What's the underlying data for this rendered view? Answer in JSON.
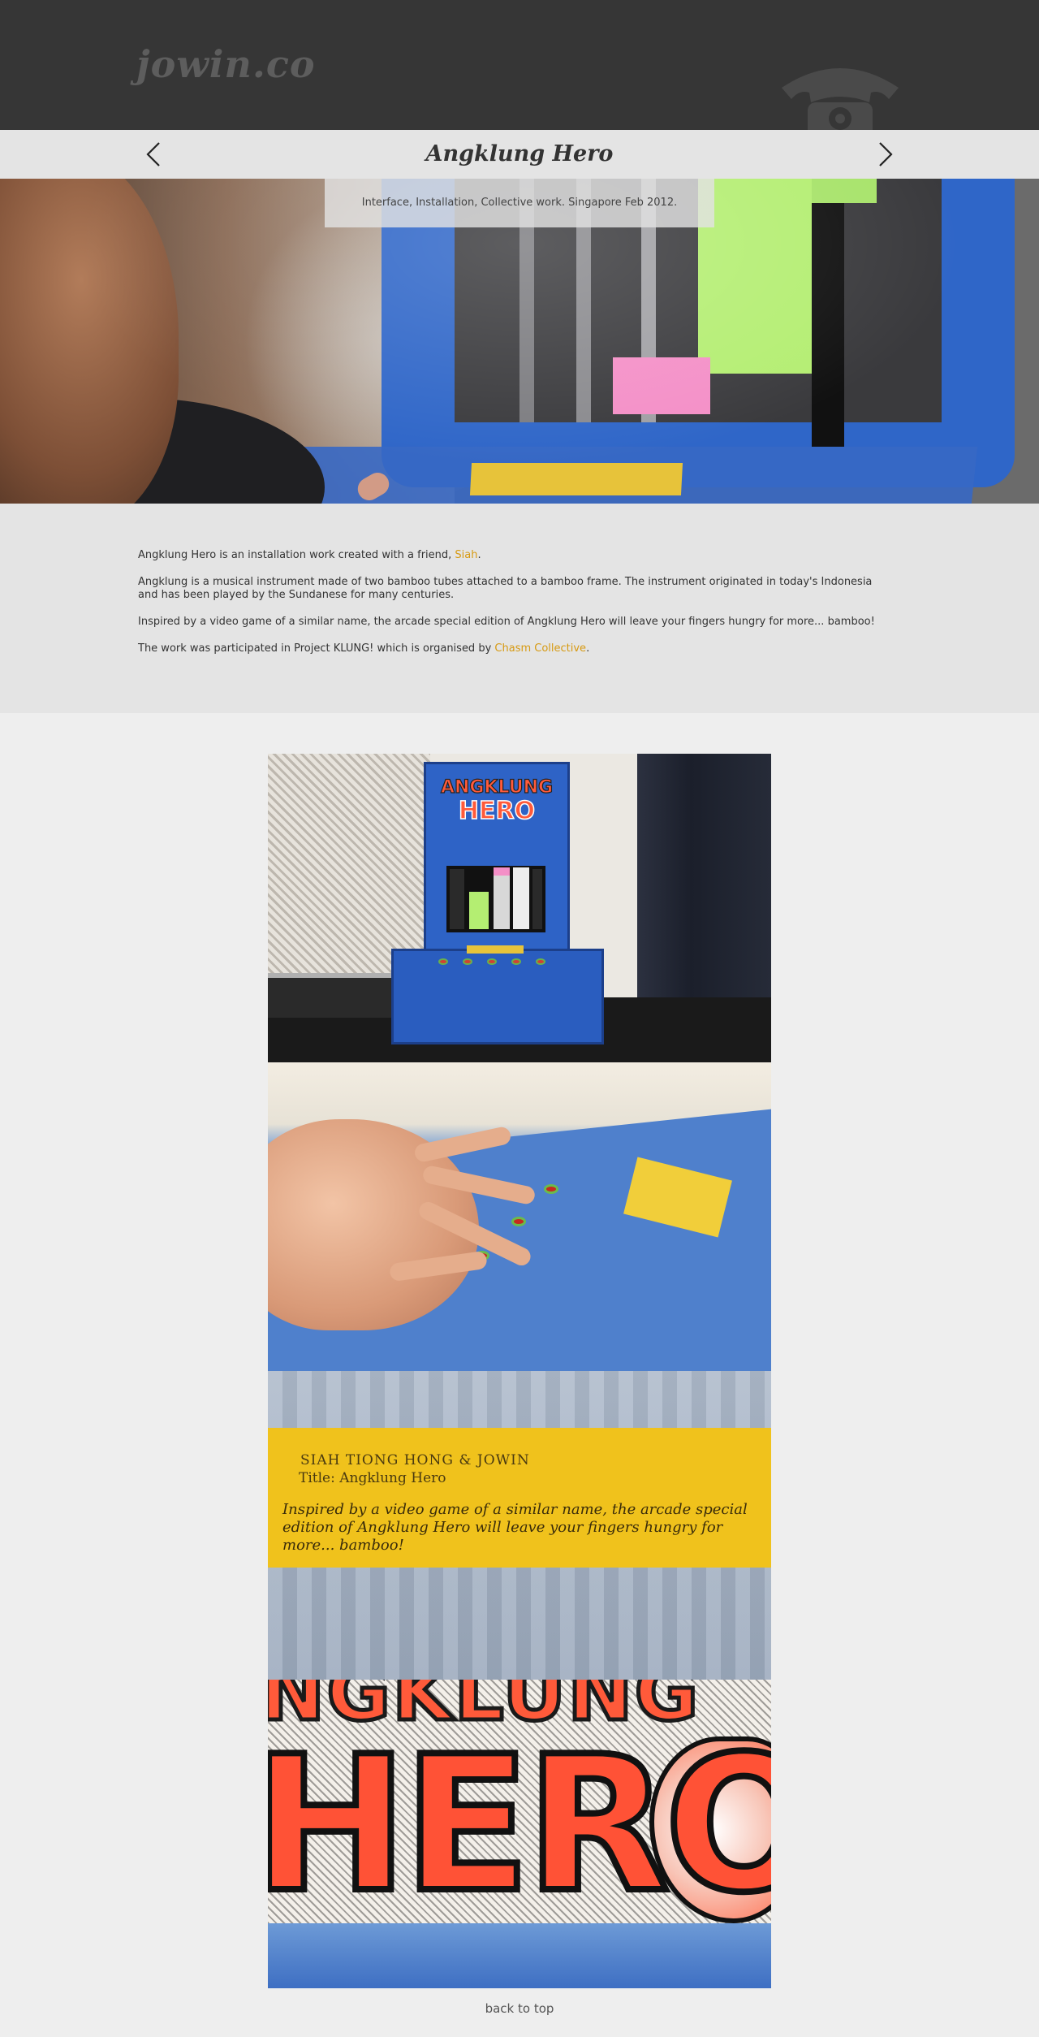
{
  "site": {
    "logo": "jowin.co"
  },
  "project": {
    "title": "Angklung Hero",
    "caption": "Interface, Installation, Collective work. Singapore Feb 2012."
  },
  "description": {
    "p1_text": "Angklung Hero is an installation work created with a friend, ",
    "p1_link": "Siah",
    "p1_end": ".",
    "p2": "Angklung is a musical instrument made of two bamboo tubes attached to a bamboo frame. The instrument originated in today's Indonesia and has been played by the Sundanese for many centuries.",
    "p3": "Inspired by a video game of a similar name, the arcade special edition of Angklung Hero will leave your fingers hungry for more... bamboo!",
    "p4_text": "The work was participated in Project KLUNG! which is organised by ",
    "p4_link": "Chasm Collective",
    "p4_end": "."
  },
  "gallery": {
    "placard_line1": "SIAH TIONG HONG & JOWIN",
    "placard_line2": "Title: Angklung Hero",
    "placard_body": "Inspired by a video game of a similar name, the arcade special edition of Angklung Hero will leave your fingers hungry for more... bamboo!",
    "sign_line1": "ANGKLUNG",
    "sign_line2": "HERO",
    "lettering_top": "NGKLUNG",
    "lettering_main": "HERO"
  },
  "footer": {
    "back_to_top": "back to top"
  },
  "colors": {
    "header_bg": "#363636",
    "title_bar_bg": "#e4e4e4",
    "link": "#d79a12",
    "page_bg": "#eeeeee"
  },
  "icons": [
    "chevron-left-icon",
    "chevron-right-icon",
    "phone-icon"
  ]
}
